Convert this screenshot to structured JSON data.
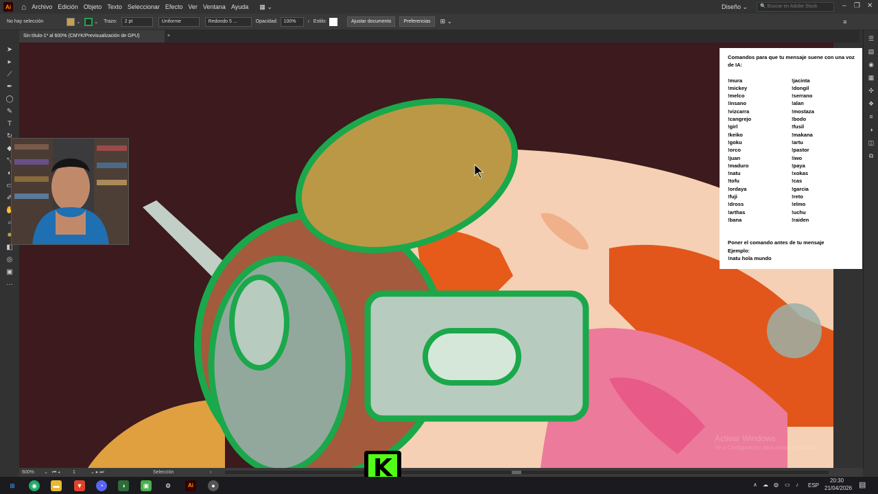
{
  "menubar": {
    "app_logo": "Ai",
    "items": [
      "Archivo",
      "Edición",
      "Objeto",
      "Texto",
      "Seleccionar",
      "Efecto",
      "Ver",
      "Ventana",
      "Ayuda"
    ],
    "workspace": "Diseño",
    "search_placeholder": "Buscar en Adobe Stock"
  },
  "controlbar": {
    "selection": "No hay selección",
    "stroke_label": "Trazo:",
    "stroke_value": "2 pt",
    "profile": "Uniforme",
    "brush": "Redondo 5 ...",
    "opacity_label": "Opacidad:",
    "opacity_value": "100%",
    "style_label": "Estilo:",
    "adjust_button": "Ajustar documento",
    "prefs_button": "Preferencias"
  },
  "document_tab": {
    "title": "Sin título-1* al 600% (CMYK/Previsualización de GPU)",
    "close": "×"
  },
  "overlay": {
    "title": "Comandos para que tu mensaje suene con una voz de IA:",
    "left_commands": [
      "!mura",
      "!mickey",
      "!melco",
      "!insano",
      "!vizcarra",
      "!cangrejo",
      "!girl",
      "!keiko",
      "!goku",
      "!orco",
      "!juan",
      "!maduro",
      "!natu",
      "!tofu",
      "!ordaya",
      "!fuji",
      "!dross",
      "!arthas",
      "!bana"
    ],
    "right_commands": [
      "!jacinta",
      "!dongil",
      "!serrano",
      "!alan",
      "!mostaza",
      "!bodo",
      "!fusil",
      "!makana",
      "!artu",
      "!pastor",
      "!iwo",
      "!paya",
      "!xokas",
      "!cas",
      "!garcia",
      "!reto",
      "!elmo",
      "!uchu",
      "!raiden"
    ],
    "footer_line1": "Poner el comando antes de tu mensaje",
    "footer_line2": "Ejemplo:",
    "footer_line3": "!natu hola mundo"
  },
  "watermark": {
    "title": "Activar Windows",
    "subtitle": "Ve a Configuración para activar Windows."
  },
  "statusbar": {
    "zoom": "600%",
    "artboard": "1",
    "tool": "Selección"
  },
  "taskbar": {
    "time": "20:30",
    "date": "21/04/2026",
    "lang": "ESP"
  },
  "colors": {
    "fill_swatch": "#c7a04d",
    "stroke_green": "#1aa84b",
    "canvas_bg": "#3c1a1e",
    "kick_green": "#53fc18"
  }
}
